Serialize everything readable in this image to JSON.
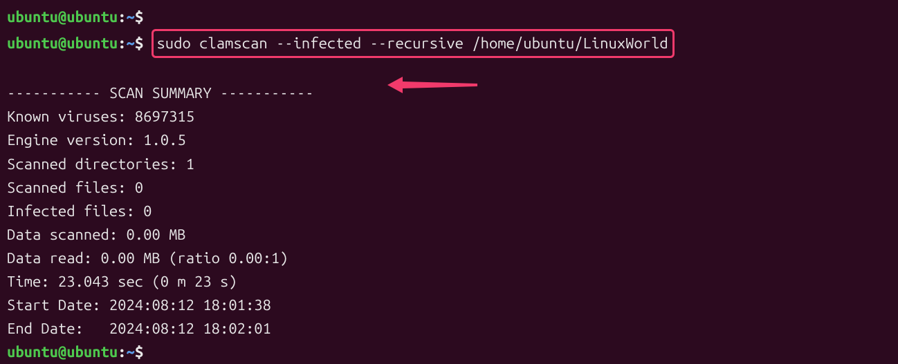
{
  "prompt": {
    "user": "ubuntu@ubuntu",
    "colon": ":",
    "path": "~",
    "symbol": "$"
  },
  "command": "sudo clamscan --infected --recursive /home/ubuntu/LinuxWorld",
  "summary": {
    "header": "----------- SCAN SUMMARY -----------",
    "lines": [
      "Known viruses: 8697315",
      "Engine version: 1.0.5",
      "Scanned directories: 1",
      "Scanned files: 0",
      "Infected files: 0",
      "Data scanned: 0.00 MB",
      "Data read: 0.00 MB (ratio 0.00:1)",
      "Time: 23.043 sec (0 m 23 s)",
      "Start Date: 2024:08:12 18:01:38",
      "End Date:   2024:08:12 18:02:01"
    ]
  }
}
